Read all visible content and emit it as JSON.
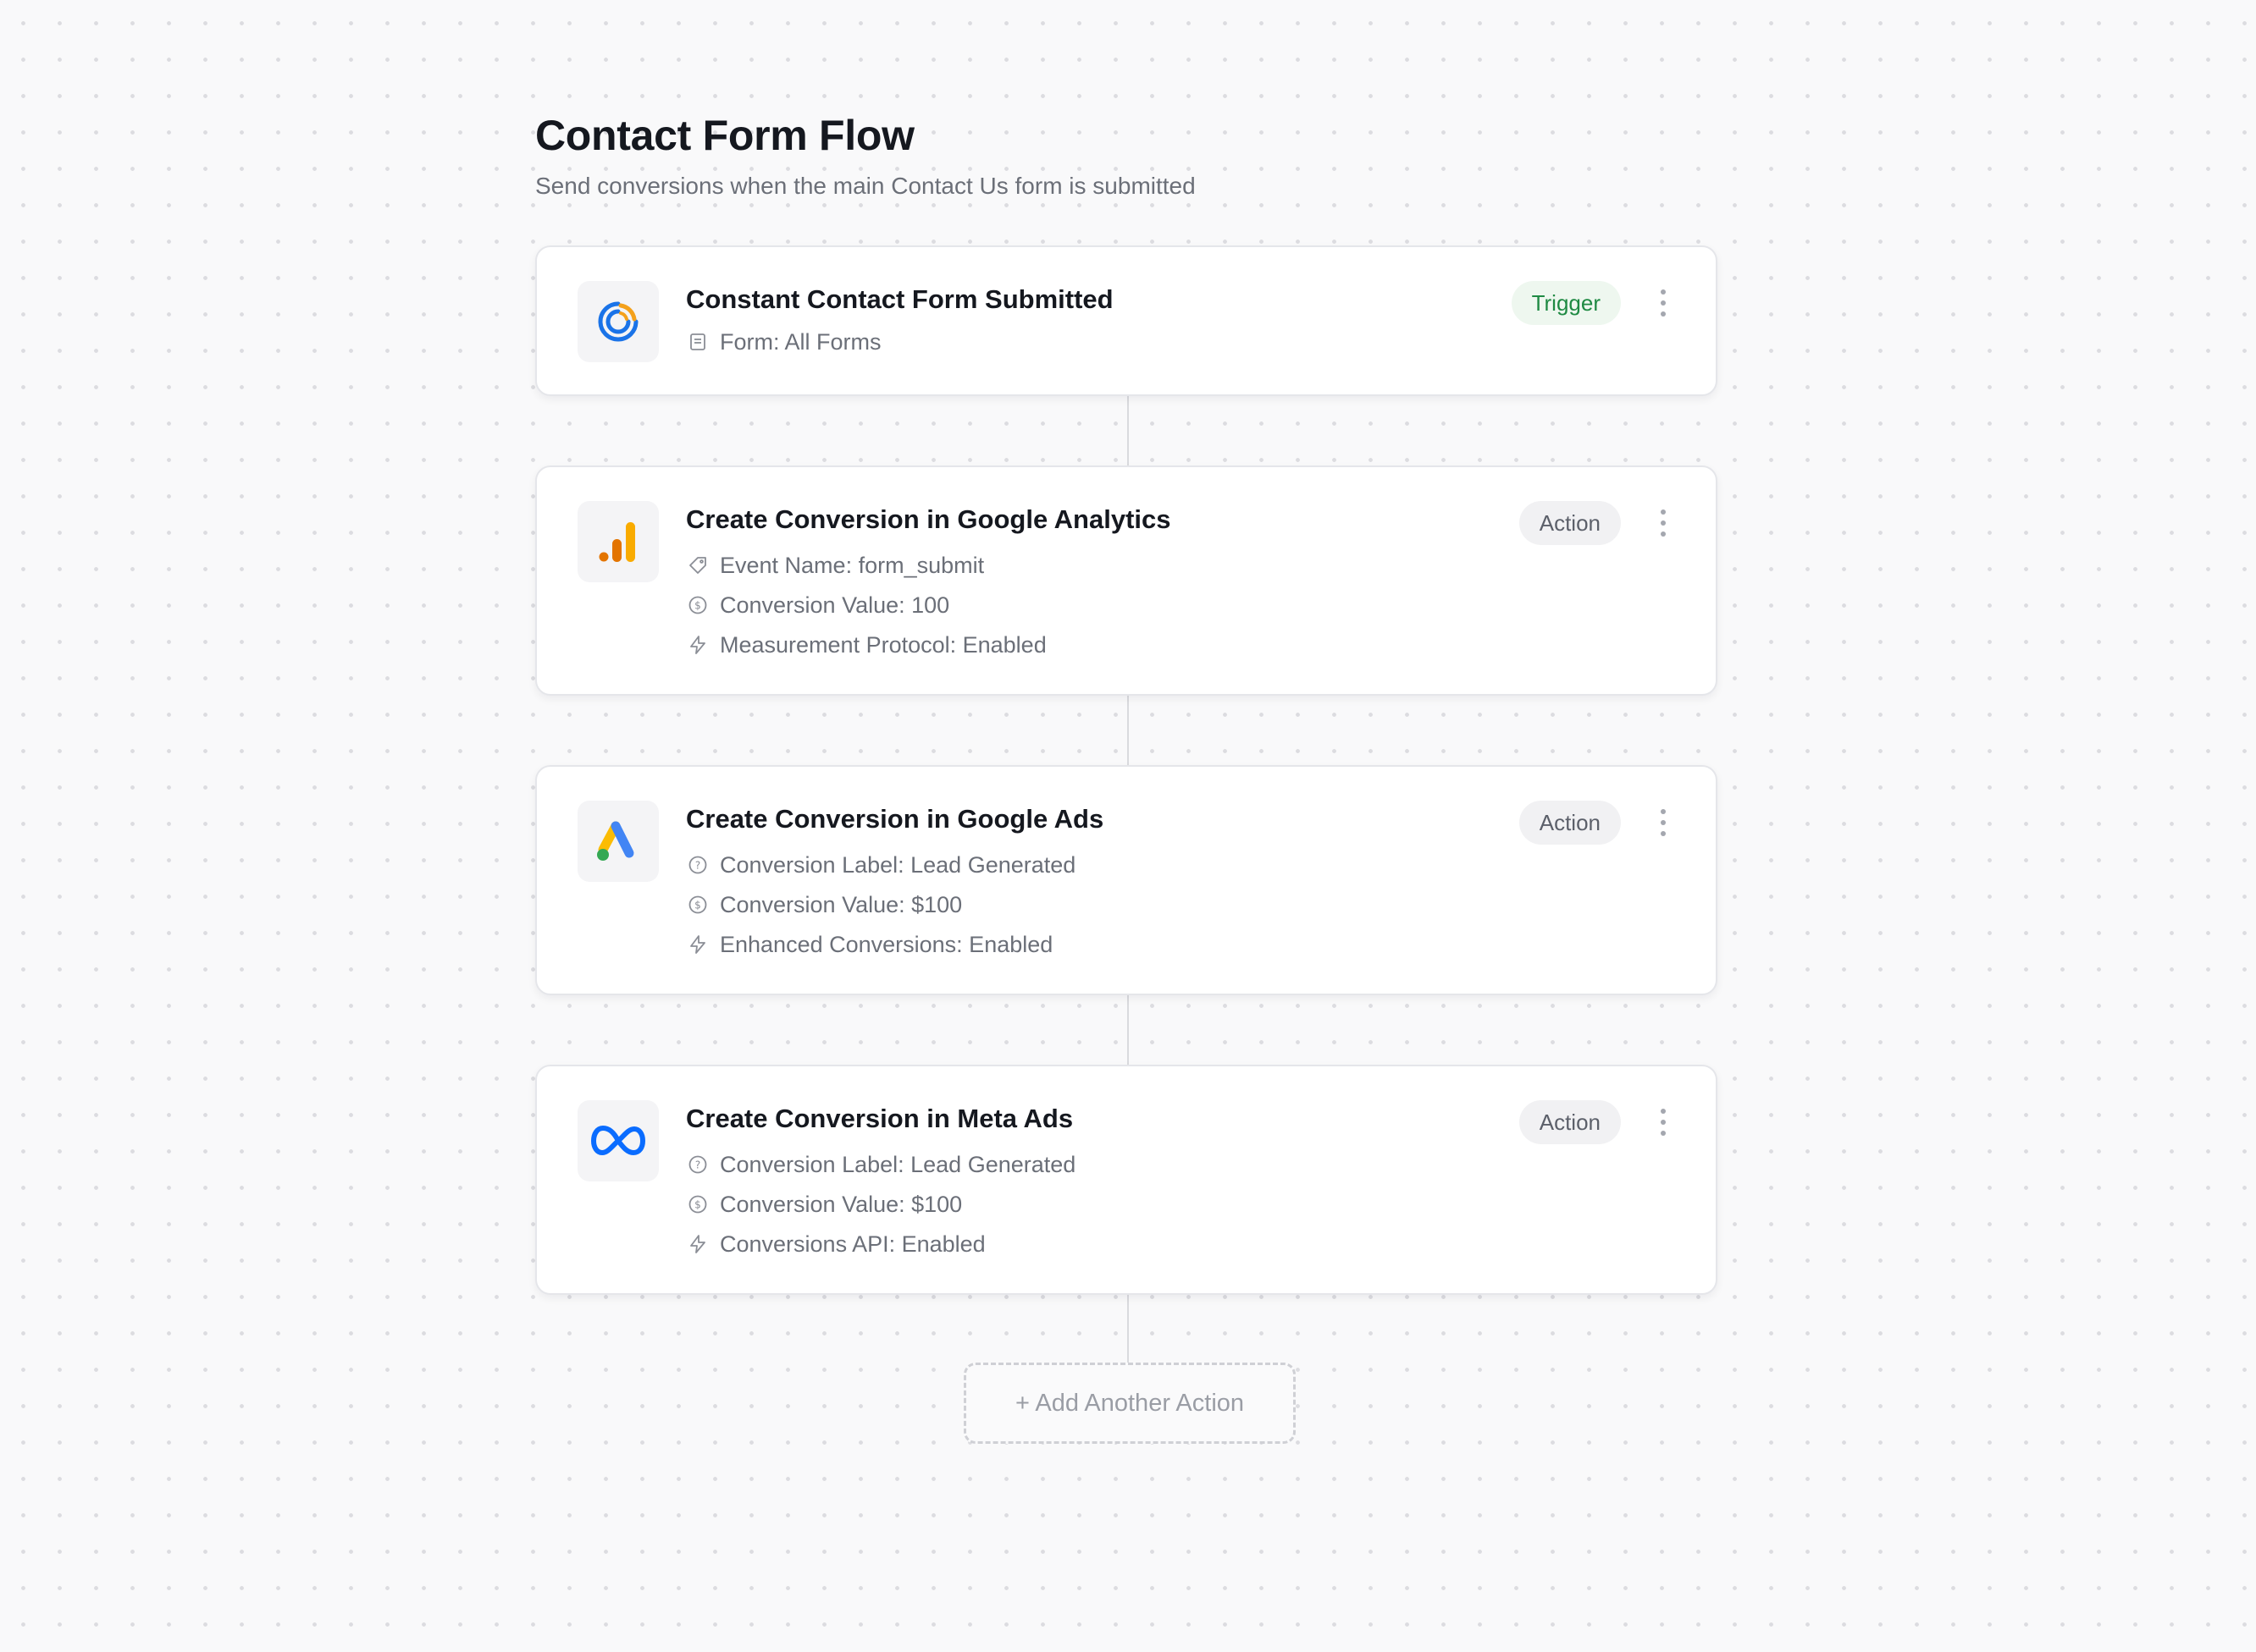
{
  "header": {
    "title": "Contact Form Flow",
    "subtitle": "Send conversions when the main Contact Us form is submitted"
  },
  "steps": [
    {
      "title": "Constant Contact Form Submitted",
      "badge": "Trigger",
      "logo": "constant-contact-logo",
      "details": [
        {
          "icon": "form-icon",
          "text": "Form: All Forms"
        }
      ]
    },
    {
      "title": "Create Conversion in Google Analytics",
      "badge": "Action",
      "logo": "google-analytics-logo",
      "details": [
        {
          "icon": "tag-icon",
          "text": "Event Name: form_submit"
        },
        {
          "icon": "dollar-icon",
          "text": "Conversion Value: 100"
        },
        {
          "icon": "lightning-icon",
          "text": "Measurement Protocol: Enabled"
        }
      ]
    },
    {
      "title": "Create Conversion in Google Ads",
      "badge": "Action",
      "logo": "google-ads-logo",
      "details": [
        {
          "icon": "question-icon",
          "text": "Conversion Label: Lead Generated"
        },
        {
          "icon": "dollar-icon",
          "text": "Conversion Value: $100"
        },
        {
          "icon": "lightning-icon",
          "text": "Enhanced Conversions: Enabled"
        }
      ]
    },
    {
      "title": "Create Conversion in Meta Ads",
      "badge": "Action",
      "logo": "meta-logo",
      "details": [
        {
          "icon": "question-icon",
          "text": "Conversion Label: Lead Generated"
        },
        {
          "icon": "dollar-icon",
          "text": "Conversion Value: $100"
        },
        {
          "icon": "lightning-icon",
          "text": "Conversions API: Enabled"
        }
      ]
    }
  ],
  "add_action_label": "+ Add Another Action",
  "colors": {
    "trigger_badge_bg": "#eef7ef",
    "trigger_badge_text": "#1f8a43",
    "action_badge_bg": "#f1f1f3",
    "muted_text": "#6b6f78"
  }
}
